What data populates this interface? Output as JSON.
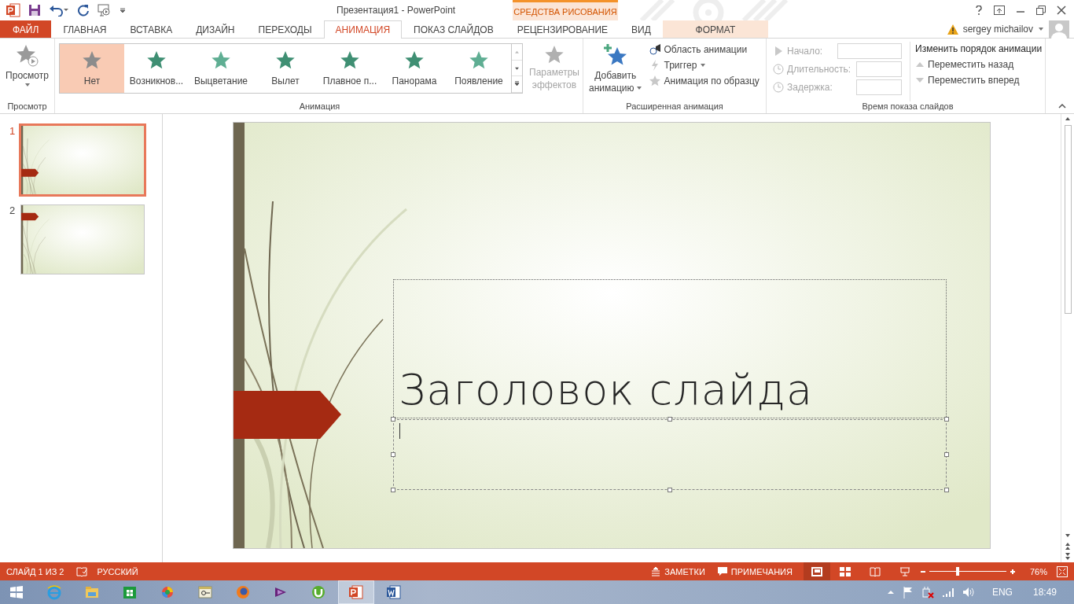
{
  "window": {
    "title": "Презентация1 - PowerPoint",
    "context_label": "СРЕДСТВА РИСОВАНИЯ",
    "user": "sergey michailov"
  },
  "tabs": [
    {
      "label": "ФАЙЛ",
      "kind": "file",
      "selected": false
    },
    {
      "label": "ГЛАВНАЯ",
      "kind": "normal",
      "selected": false
    },
    {
      "label": "ВСТАВКА",
      "kind": "normal",
      "selected": false
    },
    {
      "label": "ДИЗАЙН",
      "kind": "normal",
      "selected": false
    },
    {
      "label": "ПЕРЕХОДЫ",
      "kind": "normal",
      "selected": false
    },
    {
      "label": "АНИМАЦИЯ",
      "kind": "normal",
      "selected": true
    },
    {
      "label": "ПОКАЗ СЛАЙДОВ",
      "kind": "normal",
      "selected": false
    },
    {
      "label": "РЕЦЕНЗИРОВАНИЕ",
      "kind": "normal",
      "selected": false
    },
    {
      "label": "ВИД",
      "kind": "normal",
      "selected": false
    },
    {
      "label": "ФОРМАТ",
      "kind": "context",
      "selected": false
    }
  ],
  "ribbon": {
    "preview": {
      "button": "Просмотр",
      "group_label": "Просмотр"
    },
    "animation": {
      "group_label": "Анимация",
      "effects": [
        {
          "label": "Нет",
          "color": "#8c8c8c",
          "selected": true
        },
        {
          "label": "Возникнов...",
          "color": "#3f8f73",
          "selected": false
        },
        {
          "label": "Выцветание",
          "color": "#5fae93",
          "selected": false
        },
        {
          "label": "Вылет",
          "color": "#3f8f73",
          "selected": false
        },
        {
          "label": "Плавное п...",
          "color": "#3f8f73",
          "selected": false
        },
        {
          "label": "Панорама",
          "color": "#3f8f73",
          "selected": false
        },
        {
          "label": "Появление",
          "color": "#5fae93",
          "selected": false
        }
      ],
      "options_button": {
        "line1": "Параметры",
        "line2": "эффектов",
        "disabled": true
      }
    },
    "advanced": {
      "group_label": "Расширенная анимация",
      "add_button": {
        "line1": "Добавить",
        "line2": "анимацию"
      },
      "items": [
        {
          "label": "Область анимации",
          "disabled": false
        },
        {
          "label": "Триггер",
          "disabled": true
        },
        {
          "label": "Анимация по образцу",
          "disabled": true
        }
      ]
    },
    "timing": {
      "group_label": "Время показа слайдов",
      "fields": [
        {
          "label": "Начало:",
          "disabled": true
        },
        {
          "label": "Длительность:",
          "disabled": true
        },
        {
          "label": "Задержка:",
          "disabled": true
        }
      ],
      "reorder_title": "Изменить порядок анимации",
      "reorder": [
        {
          "label": "Переместить назад",
          "disabled": true
        },
        {
          "label": "Переместить вперед",
          "disabled": true
        }
      ]
    }
  },
  "thumbnails": [
    {
      "number": "1",
      "kind": "title",
      "selected": true
    },
    {
      "number": "2",
      "kind": "content",
      "selected": false
    }
  ],
  "slide": {
    "title": "Заголовок слайда"
  },
  "status_bar": {
    "slide_info": "СЛАЙД 1 ИЗ 2",
    "language": "РУССКИЙ",
    "notes": "ЗАМЕТКИ",
    "comments": "ПРИМЕЧАНИЯ",
    "zoom": {
      "level": 0.37
    },
    "zoom_text": "76%"
  },
  "taskbar": {
    "apps": [
      {
        "kind": "ie",
        "selected": false
      },
      {
        "kind": "files",
        "selected": false
      },
      {
        "kind": "store",
        "selected": false
      },
      {
        "kind": "ball",
        "selected": false
      },
      {
        "kind": "window",
        "selected": false
      },
      {
        "kind": "firefox",
        "selected": false
      },
      {
        "kind": "vs",
        "selected": false
      },
      {
        "kind": "torrent",
        "selected": false
      },
      {
        "kind": "ppt",
        "selected": true
      },
      {
        "kind": "word",
        "selected": false
      }
    ],
    "language": "ENG",
    "time": "18:49"
  }
}
